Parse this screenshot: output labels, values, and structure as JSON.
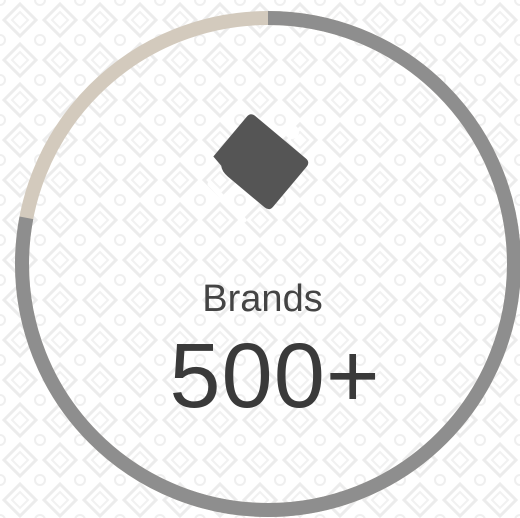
{
  "stat": {
    "label": "Brands",
    "value": "500+",
    "icon": "price-tag-icon",
    "progress_fraction": 0.78
  },
  "colors": {
    "background": "#ffffff",
    "pattern": "#efefef",
    "ring_filled": "#8e8e8e",
    "ring_remaining": "#d3cabd",
    "icon": "#555555",
    "text": "#444444"
  }
}
